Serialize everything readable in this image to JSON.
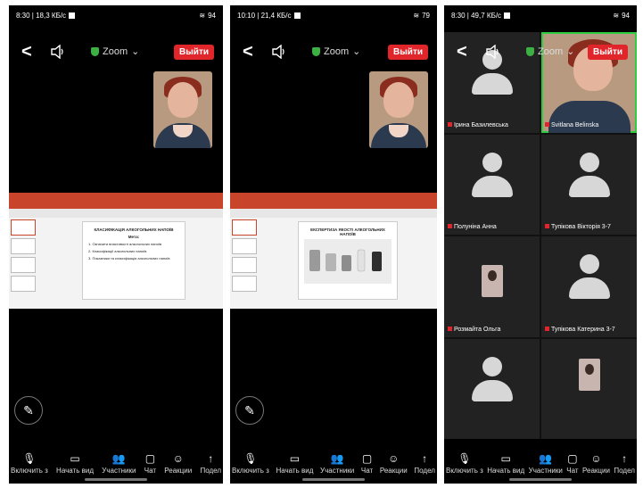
{
  "phones": [
    {
      "status": {
        "time": "8:30",
        "speed": "18,3 КБ/с",
        "battery": "94"
      },
      "topbar": {
        "back": "<",
        "app": "Zoom",
        "chevron": "⌄",
        "leave": "Выйти"
      },
      "slide": {
        "title": "КЛАСИФІКАЦІЯ АЛКОГОЛЬНИХ НАПОЇВ",
        "subtitle": "Мета:",
        "lines": [
          "1. Означити властивості алкогольних напоїв",
          "2. Класифікації алкогольних напоїв",
          "3. Показники та класифікація алкогольних напоїв"
        ]
      },
      "bottombar": [
        "Включить з",
        "Начать вид",
        "Участники",
        "Чат",
        "Реакции",
        "Подел"
      ]
    },
    {
      "status": {
        "time": "10:10",
        "speed": "21,4 КБ/с",
        "battery": "79"
      },
      "topbar": {
        "back": "<",
        "app": "Zoom",
        "chevron": "⌄",
        "leave": "Выйти"
      },
      "slide": {
        "title": "ЕКСПЕРТИЗА ЯКОСТІ АЛКОГОЛЬНИХ НАПОЇВ",
        "subtitle": "",
        "lines": []
      },
      "bottombar": [
        "Включить з",
        "Начать вид",
        "Участники",
        "Чат",
        "Реакции",
        "Подел"
      ]
    },
    {
      "status": {
        "time": "8:30",
        "speed": "49,7 КБ/с",
        "battery": "94"
      },
      "topbar": {
        "back": "<",
        "app": "Zoom",
        "chevron": "⌄",
        "leave": "Выйти"
      },
      "participants": [
        "Ірина Базилевська",
        "Svitlana Belinska",
        "Полуніна Анна",
        "Тупікова Вікторія 3-7",
        "Розмайта Ольга",
        "Тупікова Катерина 3-7",
        "",
        ""
      ],
      "bottombar": [
        "Включить з",
        "Начать вид",
        "Участники",
        "Чат",
        "Реакции",
        "Подел"
      ]
    }
  ],
  "colors": {
    "leave_red": "#e0262b",
    "shield_green": "#3cb043",
    "ppt_orange": "#c8452b",
    "active_speaker": "#2ecc40"
  }
}
